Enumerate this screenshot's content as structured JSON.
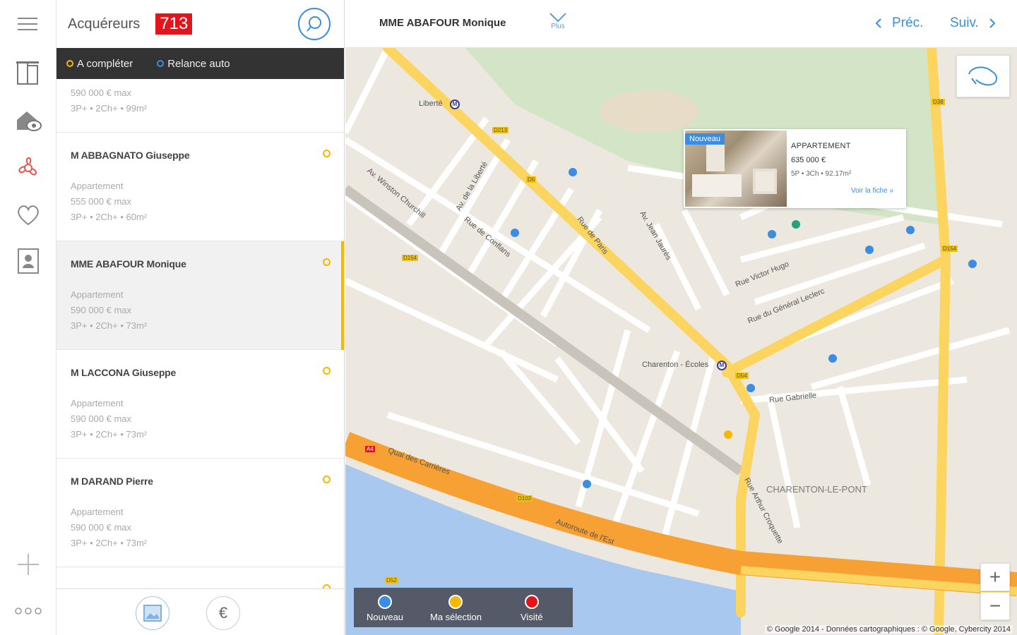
{
  "sidebar": {
    "icons": [
      "menu-icon",
      "buildings-icon",
      "house-eye-icon",
      "fan-icon",
      "heart-icon",
      "contact-card-icon",
      "plus-icon",
      "more-icon"
    ]
  },
  "list": {
    "title": "Acquéreurs",
    "count": "713",
    "filters": [
      {
        "label": "A compléter",
        "color": "#f5b800"
      },
      {
        "label": "Relance auto",
        "color": "#3b8de3"
      }
    ],
    "partial_top": {
      "budget": "590 000 € max",
      "specs": "3P+ • 2Ch+ • 99m²"
    },
    "items": [
      {
        "name": "M ABBAGNATO Giuseppe",
        "type": "Appartement",
        "budget": "555 000 € max",
        "specs": "3P+ • 2Ch+ • 60m²"
      },
      {
        "name": "MME ABAFOUR Monique",
        "type": "Appartement",
        "budget": "590 000 € max",
        "specs": "3P+ • 2Ch+ • 73m²"
      },
      {
        "name": "M LACCONA Giuseppe",
        "type": "Appartement",
        "budget": "590 000 € max",
        "specs": "3P+ • 2Ch+ • 73m²"
      },
      {
        "name": "M DARAND Pierre",
        "type": "Appartement",
        "budget": "590 000 € max",
        "specs": "3P+ • 2Ch+ • 73m²"
      }
    ],
    "footer": {
      "euro_label": "€"
    }
  },
  "detail": {
    "title": "MME ABAFOUR Monique",
    "plus_label": "Plus",
    "prev_label": "Préc.",
    "next_label": "Suiv."
  },
  "map": {
    "popup": {
      "badge": "Nouveau",
      "type": "APPARTEMENT",
      "price": "635 000 €",
      "specs": "5P • 3Ch • 92.17m²",
      "link": "Voir la fiche »"
    },
    "labels": {
      "liberte": "Liberté",
      "charenton_ecoles": "Charenton - Écoles",
      "charenton_le_pont": "CHARENTON-LE-PONT",
      "rue_de_paris": "Rue de Paris",
      "av_liberte": "Av. de la Liberté",
      "quai": "Quai des Carrières",
      "autoroute": "Autoroute de l'Est",
      "rue_gabrielle": "Rue Gabrielle",
      "av_general_leclerc": "Rue du Général Leclerc",
      "av_victor_hugo": "Rue Victor Hugo",
      "rue_arthur_croquette": "Rue Arthur Croquette",
      "av_jean_jaures": "Av. Jean Jaurès",
      "rue_de_conflans": "Rue de Conflans",
      "av_winston": "Av. Winston Churchill"
    },
    "roads": [
      "D213",
      "D6",
      "D154",
      "D54",
      "D103",
      "D52",
      "A4",
      "D38",
      "D154"
    ],
    "legend": [
      {
        "label": "Nouveau",
        "color": "#3b8de3"
      },
      {
        "label": "Ma sélection",
        "color": "#f5b800"
      },
      {
        "label": "Visité",
        "color": "#e2151c"
      }
    ],
    "zoom_in": "+",
    "zoom_out": "−",
    "copyright": "© Google 2014 - Données cartographiques : © Google, Cybercity 2014"
  }
}
